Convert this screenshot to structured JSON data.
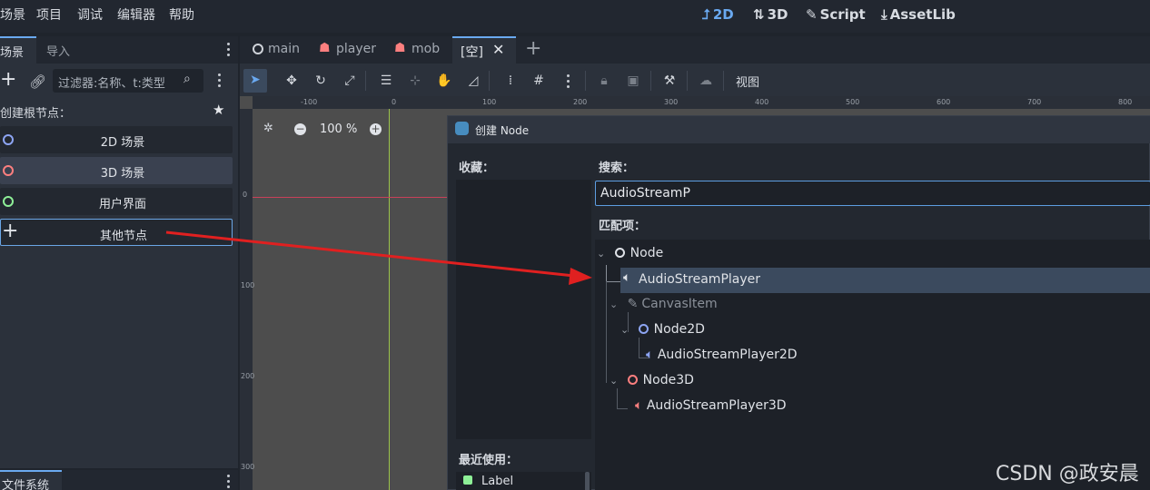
{
  "menubar": {
    "items": [
      "场景",
      "项目",
      "调试",
      "编辑器",
      "帮助"
    ],
    "workspaces": [
      {
        "icon": "2d-workspace-icon",
        "label": "2D",
        "active": true
      },
      {
        "icon": "3d-workspace-icon",
        "label": "3D",
        "active": false
      },
      {
        "icon": "script-workspace-icon",
        "label": "Script",
        "active": false
      },
      {
        "icon": "assetlib-workspace-icon",
        "label": "AssetLib",
        "active": false
      }
    ]
  },
  "scene_dock": {
    "tabs": [
      "场景",
      "导入"
    ],
    "filter_placeholder": "过滤器:名称、t:类型",
    "create_root_label": "创建根节点：",
    "root_buttons": [
      {
        "label": "2D 场景",
        "icon_color": "#8da5f3"
      },
      {
        "label": "3D 场景",
        "icon_color": "#fc7f7f"
      },
      {
        "label": "用户界面",
        "icon_color": "#8eef97"
      },
      {
        "label": "其他节点",
        "icon": "plus-icon"
      }
    ]
  },
  "filesystem_dock": {
    "tab": "文件系统"
  },
  "editor_tabs": [
    {
      "label": "main",
      "icon": "node-circle-icon"
    },
    {
      "label": "player",
      "icon": "character-icon"
    },
    {
      "label": "mob",
      "icon": "character-icon"
    },
    {
      "label": "[空]",
      "active": true
    }
  ],
  "toolbar": {
    "view_label": "视图"
  },
  "viewport": {
    "zoom": "100 %",
    "ruler_top": [
      "-100",
      "0",
      "100",
      "200",
      "300",
      "400",
      "500",
      "600",
      "700",
      "800"
    ],
    "ruler_left": [
      "0",
      "100",
      "200",
      "300"
    ]
  },
  "dialog": {
    "title": "创建 Node",
    "favorites_label": "收藏：",
    "recent_label": "最近使用：",
    "recent_items": [
      "Label"
    ],
    "search_label": "搜索：",
    "search_value": "AudioStreamP",
    "matches_label": "匹配项：",
    "tree": {
      "root": "Node",
      "items": [
        "AudioStreamPlayer",
        "CanvasItem",
        "Node2D",
        "AudioStreamPlayer2D",
        "Node3D",
        "AudioStreamPlayer3D"
      ]
    }
  },
  "watermark": "CSDN @政安晨",
  "colors": {
    "accent": "#6aa9f0",
    "arrow": "#e02020",
    "node2d": "#8da5f3",
    "node3d": "#fc7f7f",
    "control": "#8eef97"
  }
}
